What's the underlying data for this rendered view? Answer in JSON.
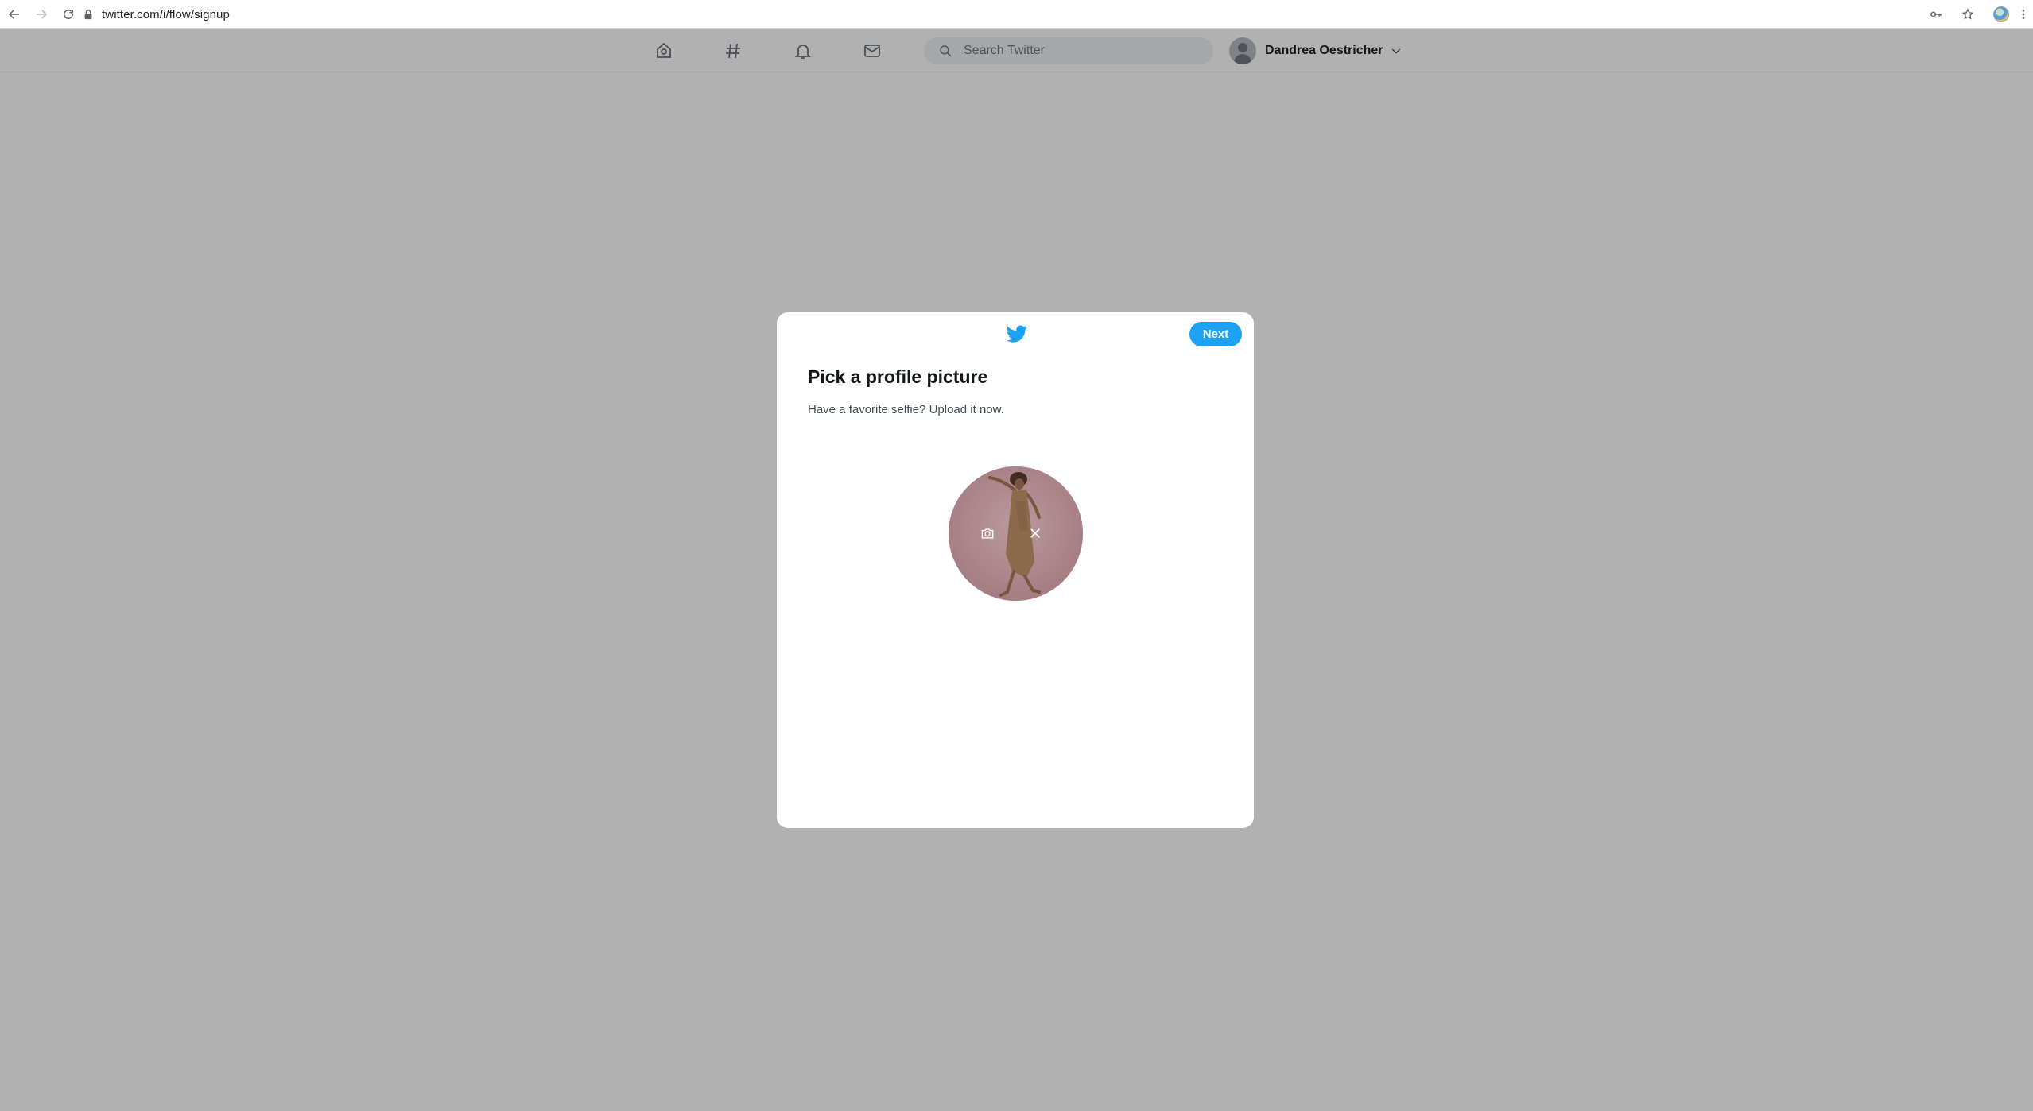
{
  "browser": {
    "url": "twitter.com/i/flow/signup",
    "icons": [
      "back-arrow-icon",
      "forward-arrow-icon",
      "reload-icon",
      "lock-icon",
      "key-icon",
      "star-icon",
      "profile-icon",
      "kebab-menu-icon"
    ]
  },
  "nav": {
    "icons": [
      "home-icon",
      "hashtag-icon",
      "bell-icon",
      "mail-icon"
    ],
    "search": {
      "placeholder": "Search Twitter",
      "value": ""
    },
    "user": {
      "name": "Dandrea Oestricher"
    }
  },
  "modal": {
    "title": "Pick a profile picture",
    "subtitle": "Have a favorite selfie? Upload it now.",
    "next_label": "Next",
    "accent": "#1da1f2",
    "avatar": {
      "icons": [
        "camera-icon",
        "close-icon"
      ]
    }
  },
  "colors": {
    "backdrop": "#b1b1b1",
    "accent": "#1da1f2"
  }
}
